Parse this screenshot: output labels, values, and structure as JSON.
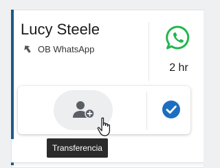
{
  "card": {
    "contact_name": "Lucy Steele",
    "source_label": "OB WhatsApp",
    "elapsed": "2 hr",
    "channel_icon": "whatsapp-icon",
    "direction_icon": "outbound-arrow-icon"
  },
  "actions": {
    "transfer_icon": "add-user-icon",
    "transfer_tooltip": "Transferencia",
    "complete_icon": "check-circle-icon"
  },
  "colors": {
    "accent": "#1f5a87",
    "whatsapp": "#25b54f",
    "check": "#1c6fc0",
    "tooltip_bg": "#2b2b2b"
  }
}
